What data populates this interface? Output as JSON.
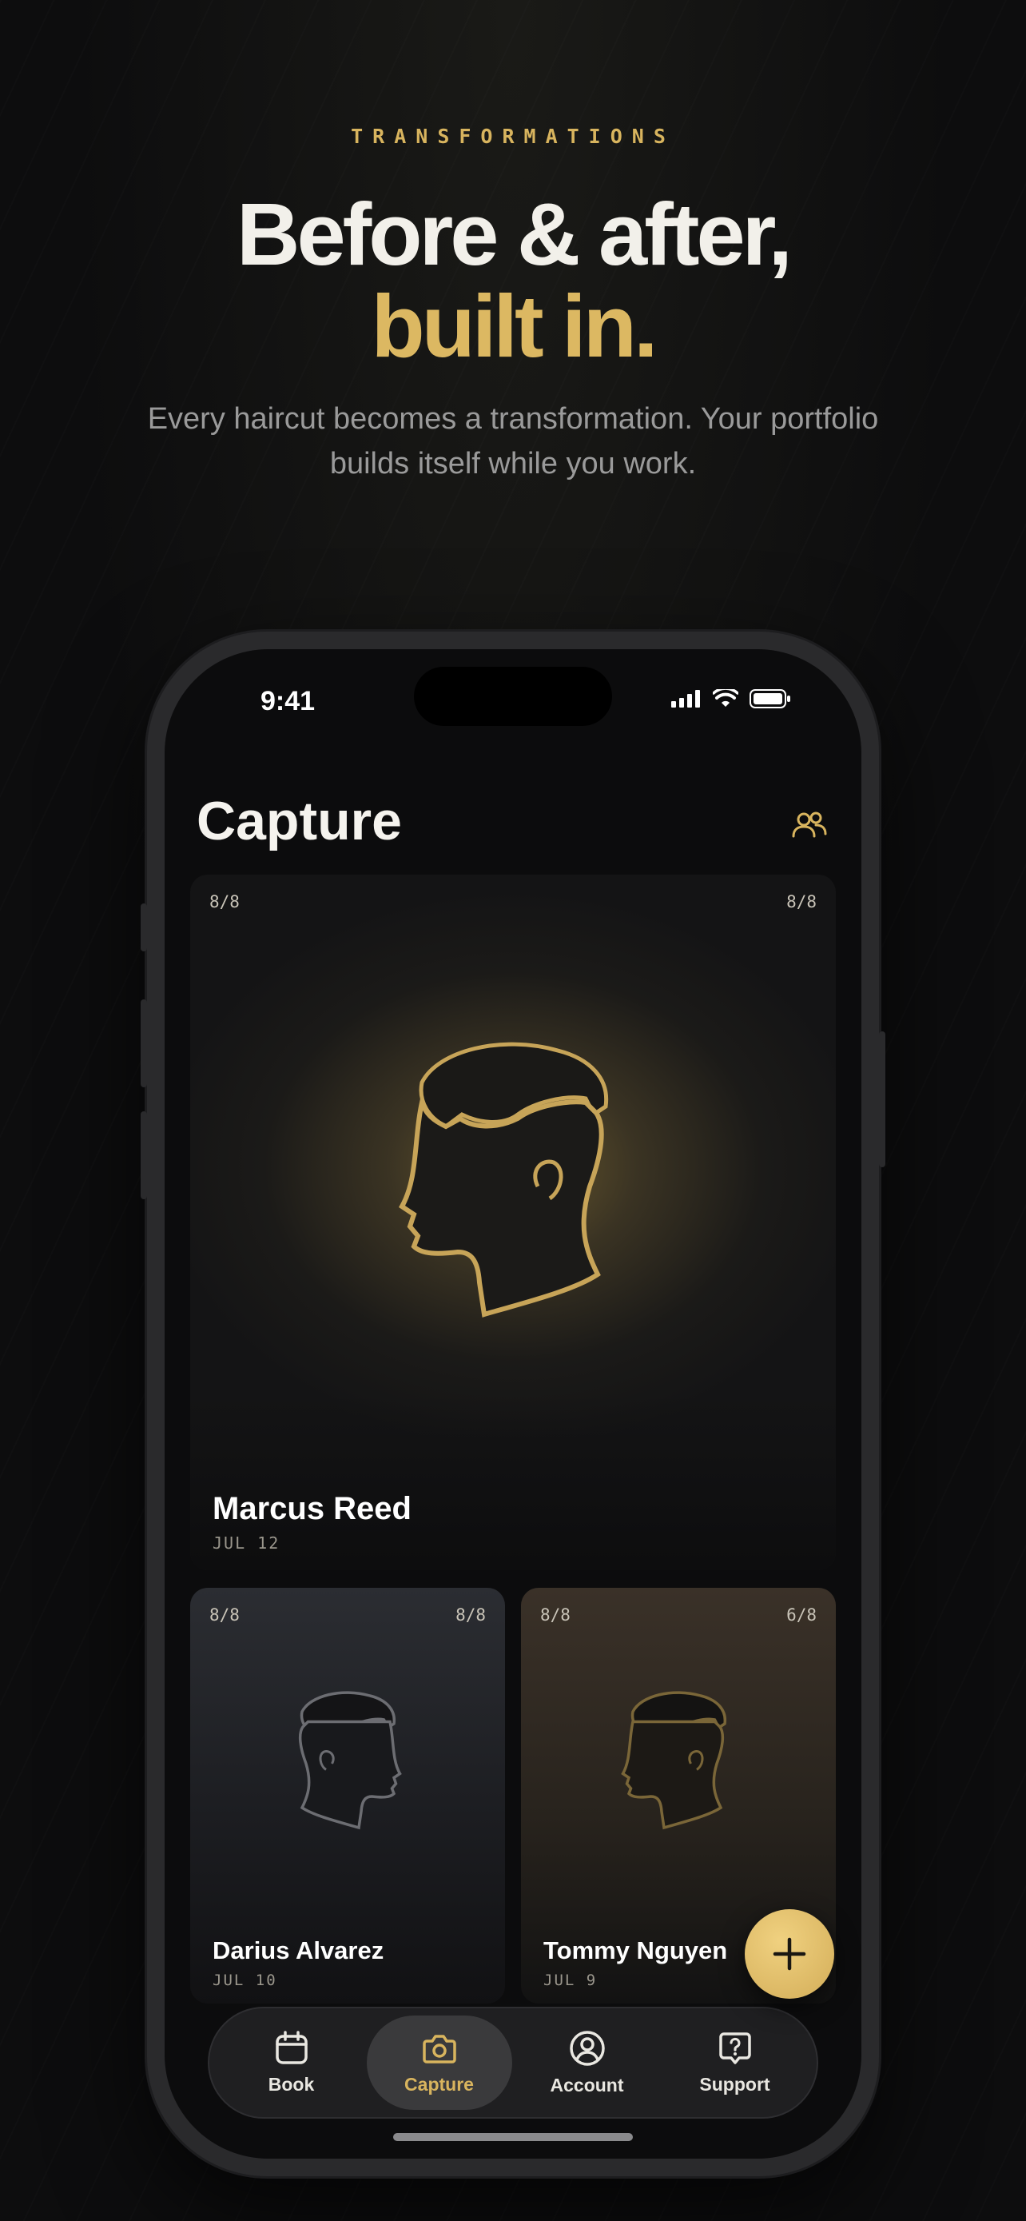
{
  "hero": {
    "eyebrow": "TRANSFORMATIONS",
    "headline_line1": "Before & after,",
    "headline_line2": "built in.",
    "subtitle": "Every haircut becomes a transformation. Your portfolio builds itself while you work."
  },
  "status_bar": {
    "time": "9:41"
  },
  "screen": {
    "title": "Capture",
    "team_icon": "people-icon"
  },
  "cards": [
    {
      "name": "Marcus Reed",
      "date": "JUL 12",
      "count_left": "8/8",
      "count_right": "8/8"
    },
    {
      "name": "Darius Alvarez",
      "date": "JUL 10",
      "count_left": "8/8",
      "count_right": "8/8"
    },
    {
      "name": "Tommy Nguyen",
      "date": "JUL 9",
      "count_left": "8/8",
      "count_right": "6/8"
    }
  ],
  "fab": {
    "icon": "plus-icon"
  },
  "tabbar": {
    "tabs": [
      {
        "label": "Book",
        "icon": "calendar-icon",
        "active": false
      },
      {
        "label": "Capture",
        "icon": "camera-icon",
        "active": true
      },
      {
        "label": "Account",
        "icon": "user-circle-icon",
        "active": false
      },
      {
        "label": "Support",
        "icon": "help-bubble-icon",
        "active": false
      }
    ]
  },
  "colors": {
    "accent_gold": "#D8B45E",
    "background": "#0D0D0E",
    "text_primary": "#F2F0EA",
    "text_muted": "#9A9A9A"
  }
}
